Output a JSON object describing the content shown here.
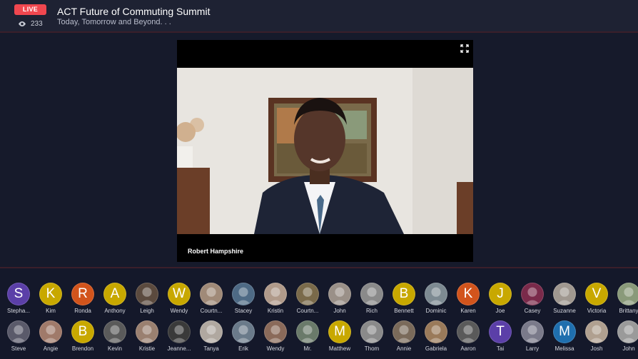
{
  "header": {
    "live_label": "LIVE",
    "viewer_count": "233",
    "title": "ACT Future of Commuting Summit",
    "subtitle": "Today, Tomorrow and Beyond. . ."
  },
  "player": {
    "speaker_name": "Robert Hampshire"
  },
  "colors": {
    "live": "#f0474f",
    "yellow": "#c8a800",
    "orange": "#d2541c",
    "purple": "#5b3fa8",
    "blue": "#1f6fae"
  },
  "attendees_row1": [
    {
      "name": "Stepha...",
      "initial": "S",
      "color": "#5b3fa8"
    },
    {
      "name": "Kim",
      "initial": "K",
      "color": "#c8a800"
    },
    {
      "name": "Ronda",
      "initial": "R",
      "color": "#d2541c"
    },
    {
      "name": "Anthony",
      "initial": "A",
      "color": "#c8a800"
    },
    {
      "name": "Leigh",
      "initial": "",
      "color": "#5b4a3e"
    },
    {
      "name": "Wendy",
      "initial": "W",
      "color": "#c8a800"
    },
    {
      "name": "Courtn...",
      "initial": "",
      "color": "#a08a78"
    },
    {
      "name": "Stacey",
      "initial": "",
      "color": "#4e6a85"
    },
    {
      "name": "Kristin",
      "initial": "",
      "color": "#b09a8a"
    },
    {
      "name": "Courtn...",
      "initial": "",
      "color": "#7a6a4a"
    },
    {
      "name": "John",
      "initial": "",
      "color": "#9a9088"
    },
    {
      "name": "Rich",
      "initial": "",
      "color": "#8a8a8a"
    },
    {
      "name": "Bennett",
      "initial": "B",
      "color": "#c8a800"
    },
    {
      "name": "Dominic",
      "initial": "",
      "color": "#7d8a92"
    },
    {
      "name": "Karen",
      "initial": "K",
      "color": "#d2541c"
    },
    {
      "name": "Joe",
      "initial": "J",
      "color": "#c8a800"
    },
    {
      "name": "Casey",
      "initial": "",
      "color": "#7a2a4a"
    },
    {
      "name": "Suzanne",
      "initial": "",
      "color": "#a09890"
    },
    {
      "name": "Victoria",
      "initial": "V",
      "color": "#c8a800"
    },
    {
      "name": "Brittany",
      "initial": "",
      "color": "#8a9a7a"
    }
  ],
  "attendees_row2": [
    {
      "name": "Steve",
      "initial": "",
      "color": "#5a5a6a"
    },
    {
      "name": "Angie",
      "initial": "",
      "color": "#a07a6a"
    },
    {
      "name": "Brendon",
      "initial": "B",
      "color": "#c8a800"
    },
    {
      "name": "Kevin",
      "initial": "",
      "color": "#5a5a5a"
    },
    {
      "name": "Kristie",
      "initial": "",
      "color": "#9a8070"
    },
    {
      "name": "Jeanne...",
      "initial": "",
      "color": "#3a3a3a"
    },
    {
      "name": "Tanya",
      "initial": "",
      "color": "#b0a8a0"
    },
    {
      "name": "Erik",
      "initial": "",
      "color": "#6a7a8a"
    },
    {
      "name": "Wendy",
      "initial": "",
      "color": "#8a6a5a"
    },
    {
      "name": "Mr.",
      "initial": "",
      "color": "#6a7a6a"
    },
    {
      "name": "Matthew",
      "initial": "M",
      "color": "#c8a800"
    },
    {
      "name": "Thom",
      "initial": "",
      "color": "#8a8a8a"
    },
    {
      "name": "Annie",
      "initial": "",
      "color": "#7a6a5a"
    },
    {
      "name": "Gabriela",
      "initial": "",
      "color": "#9a7a5a"
    },
    {
      "name": "Aaron",
      "initial": "",
      "color": "#5a5a5a"
    },
    {
      "name": "Tai",
      "initial": "T",
      "color": "#5b3fa8"
    },
    {
      "name": "Larry",
      "initial": "",
      "color": "#7a7a8a"
    },
    {
      "name": "Melissa",
      "initial": "M",
      "color": "#1f6fae"
    },
    {
      "name": "Josh",
      "initial": "",
      "color": "#b0a090"
    },
    {
      "name": "John",
      "initial": "",
      "color": "#9a9a9a"
    }
  ]
}
